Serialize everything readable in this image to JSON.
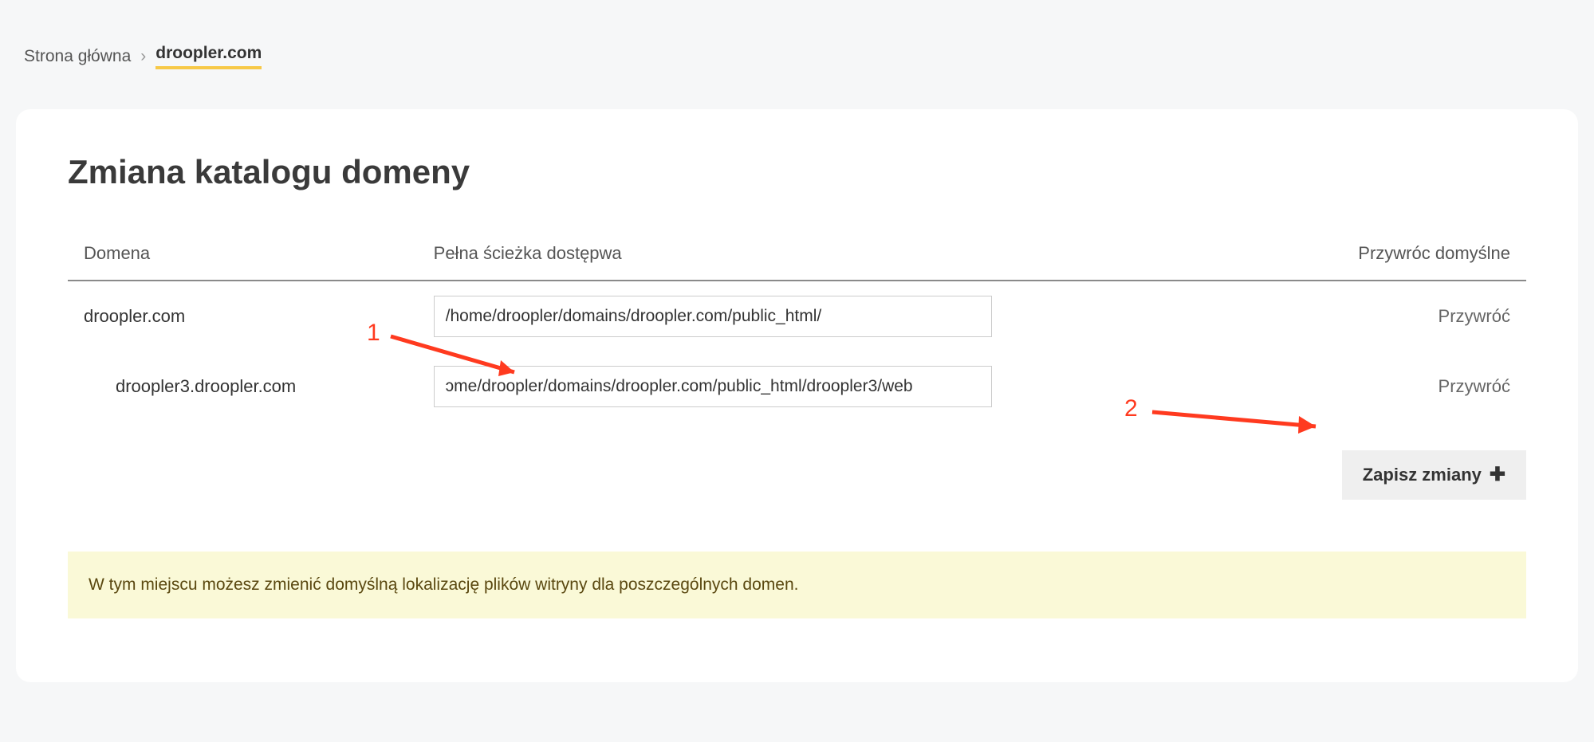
{
  "breadcrumb": {
    "home": "Strona główna",
    "sep": "›",
    "current": "droopler.com"
  },
  "page": {
    "title": "Zmiana katalogu domeny"
  },
  "table": {
    "headers": {
      "domain": "Domena",
      "path": "Pełna ścieżka dostępwa",
      "restore": "Przywróc domyślne"
    },
    "rows": [
      {
        "domain": "droopler.com",
        "path": "/home/droopler/domains/droopler.com/public_html/",
        "restore": "Przywróć",
        "indent": false
      },
      {
        "domain": "droopler3.droopler.com",
        "path": "ɔme/droopler/domains/droopler.com/public_html/droopler3/web",
        "restore": "Przywróć",
        "indent": true
      }
    ]
  },
  "actions": {
    "save": "Zapisz zmiany"
  },
  "notice": {
    "text": "W tym miejscu możesz zmienić domyślną lokalizację plików witryny dla poszczególnych domen."
  },
  "annotations": {
    "one": "1",
    "two": "2"
  }
}
